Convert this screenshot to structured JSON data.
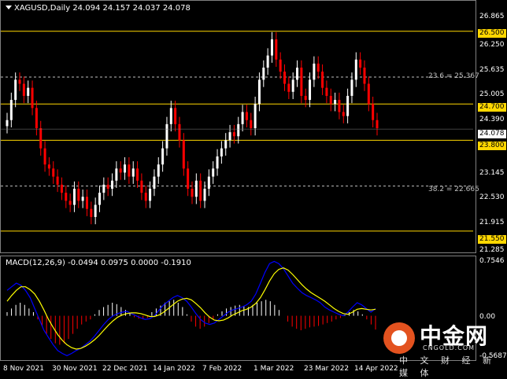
{
  "chart": {
    "symbol_info": "XAGUSD,Daily",
    "ohlc_text": "24.094 24.157 24.037 24.078",
    "macd_info": "MACD(12,26,9) -0.0494 0.0975 0.0000 -0.1910",
    "colors": {
      "bull": "#ffffff",
      "bear": "#ff0000",
      "level": "#ffd700",
      "macd_hist_pos": "#ffffff",
      "macd_hist_neg": "#ff0000",
      "macd_line": "#0000ff",
      "signal_line": "#ffff00"
    }
  },
  "price_axis": [
    {
      "label": "26.865"
    },
    {
      "label": "26.250"
    },
    {
      "label": "25.635"
    },
    {
      "label": "25.005"
    },
    {
      "label": "24.390"
    },
    {
      "label": "23.145"
    },
    {
      "label": "22.530"
    },
    {
      "label": "21.915"
    },
    {
      "label": "21.285"
    }
  ],
  "levels": [
    {
      "label": "26.500",
      "value": 26.5
    },
    {
      "label": "24.700",
      "value": 24.7
    },
    {
      "label": "23.800",
      "value": 23.8
    },
    {
      "label": "21.550",
      "value": 21.55
    }
  ],
  "current_price": {
    "label": "24.078",
    "value": 24.078
  },
  "fib_levels": [
    {
      "label": "23.6 = 25.367",
      "value": 25.367
    },
    {
      "label": "38.2 = 22.665",
      "value": 22.665
    }
  ],
  "macd_axis": [
    {
      "label": "0.7546"
    },
    {
      "label": "0.00"
    },
    {
      "label": "-0.5687"
    }
  ],
  "time_axis": [
    {
      "label": "8 Nov 2021"
    },
    {
      "label": "30 Nov 2021"
    },
    {
      "label": "22 Dec 2021"
    },
    {
      "label": "14 Jan 2022"
    },
    {
      "label": "7 Feb 2022"
    },
    {
      "label": "1 Mar 2022"
    },
    {
      "label": "23 Mar 2022"
    },
    {
      "label": "14 Apr 2022"
    }
  ],
  "watermark": {
    "name": "中金网",
    "url": "CNGOLD.COM",
    "slogan": "中 文 财 经 新 媒 体"
  },
  "chart_data": {
    "type": "candlestick",
    "price_range": [
      21.1,
      27.1
    ],
    "macd_range": [
      -0.5687,
      0.7546
    ],
    "closes": [
      24.3,
      24.8,
      25.3,
      25.2,
      24.9,
      25.1,
      24.6,
      24.1,
      23.6,
      23.2,
      23.1,
      22.9,
      22.7,
      22.5,
      22.3,
      22.2,
      22.6,
      22.3,
      22.4,
      22.1,
      21.9,
      22.2,
      22.5,
      22.7,
      22.6,
      22.8,
      23.1,
      23.0,
      23.2,
      22.9,
      23.1,
      22.8,
      22.5,
      22.3,
      22.6,
      22.9,
      23.2,
      23.6,
      24.2,
      24.6,
      24.2,
      23.8,
      23.1,
      22.6,
      22.4,
      22.8,
      22.3,
      22.6,
      22.9,
      23.1,
      23.4,
      23.6,
      23.8,
      24.0,
      23.9,
      24.2,
      24.5,
      24.3,
      24.1,
      24.7,
      25.3,
      25.6,
      25.9,
      26.3,
      25.8,
      25.5,
      25.2,
      25.0,
      25.3,
      25.6,
      24.9,
      24.8,
      25.3,
      25.7,
      25.5,
      25.1,
      24.9,
      24.7,
      24.8,
      24.5,
      24.4,
      24.9,
      25.3,
      25.8,
      25.6,
      25.2,
      24.7,
      24.3,
      24.1
    ],
    "macd_hist": [
      0.05,
      0.1,
      0.15,
      0.18,
      0.15,
      0.1,
      0.05,
      -0.05,
      -0.15,
      -0.25,
      -0.32,
      -0.38,
      -0.4,
      -0.38,
      -0.32,
      -0.25,
      -0.18,
      -0.12,
      -0.08,
      -0.05,
      0.02,
      0.08,
      0.12,
      0.15,
      0.18,
      0.16,
      0.12,
      0.08,
      0.04,
      -0.02,
      -0.04,
      -0.05,
      -0.03,
      0.05,
      0.1,
      0.14,
      0.18,
      0.2,
      0.22,
      0.18,
      0.12,
      0.02,
      -0.08,
      -0.15,
      -0.18,
      -0.15,
      -0.1,
      -0.05,
      0.02,
      0.06,
      0.1,
      0.12,
      0.14,
      0.15,
      0.13,
      0.12,
      0.15,
      0.18,
      0.2,
      0.22,
      0.2,
      0.15,
      0.08,
      0.0,
      -0.08,
      -0.15,
      -0.18,
      -0.2,
      -0.18,
      -0.16,
      -0.15,
      -0.14,
      -0.12,
      -0.1,
      -0.08,
      -0.05,
      -0.03,
      0.02,
      0.05,
      0.08,
      0.06,
      0.02,
      -0.05,
      -0.12,
      -0.19
    ],
    "macd_line": [
      0.35,
      0.4,
      0.45,
      0.42,
      0.35,
      0.25,
      0.1,
      -0.05,
      -0.2,
      -0.3,
      -0.4,
      -0.48,
      -0.52,
      -0.55,
      -0.52,
      -0.48,
      -0.45,
      -0.4,
      -0.35,
      -0.28,
      -0.2,
      -0.12,
      -0.05,
      0.0,
      0.03,
      0.05,
      0.06,
      0.03,
      0.0,
      -0.03,
      -0.05,
      -0.04,
      0.0,
      0.08,
      0.15,
      0.2,
      0.25,
      0.28,
      0.25,
      0.2,
      0.12,
      0.03,
      -0.05,
      -0.1,
      -0.12,
      -0.1,
      -0.05,
      0.0,
      0.05,
      0.08,
      0.1,
      0.12,
      0.15,
      0.2,
      0.3,
      0.45,
      0.6,
      0.72,
      0.75,
      0.72,
      0.65,
      0.55,
      0.45,
      0.38,
      0.32,
      0.28,
      0.25,
      0.22,
      0.18,
      0.12,
      0.08,
      0.05,
      0.02,
      0.0,
      0.05,
      0.12,
      0.18,
      0.15,
      0.1,
      0.05,
      0.1
    ],
    "signal_line": [
      0.2,
      0.28,
      0.35,
      0.4,
      0.4,
      0.36,
      0.3,
      0.2,
      0.08,
      -0.05,
      -0.16,
      -0.26,
      -0.34,
      -0.4,
      -0.44,
      -0.46,
      -0.45,
      -0.42,
      -0.38,
      -0.33,
      -0.27,
      -0.2,
      -0.13,
      -0.07,
      -0.02,
      0.01,
      0.03,
      0.04,
      0.04,
      0.03,
      0.01,
      -0.01,
      -0.01,
      0.01,
      0.05,
      0.1,
      0.15,
      0.2,
      0.23,
      0.24,
      0.22,
      0.17,
      0.11,
      0.04,
      -0.02,
      -0.06,
      -0.07,
      -0.06,
      -0.03,
      0.01,
      0.04,
      0.07,
      0.09,
      0.12,
      0.17,
      0.25,
      0.36,
      0.48,
      0.58,
      0.64,
      0.66,
      0.63,
      0.57,
      0.5,
      0.43,
      0.37,
      0.32,
      0.28,
      0.24,
      0.2,
      0.15,
      0.1,
      0.06,
      0.03,
      0.02,
      0.05,
      0.09,
      0.1,
      0.09,
      0.08,
      0.09
    ]
  }
}
